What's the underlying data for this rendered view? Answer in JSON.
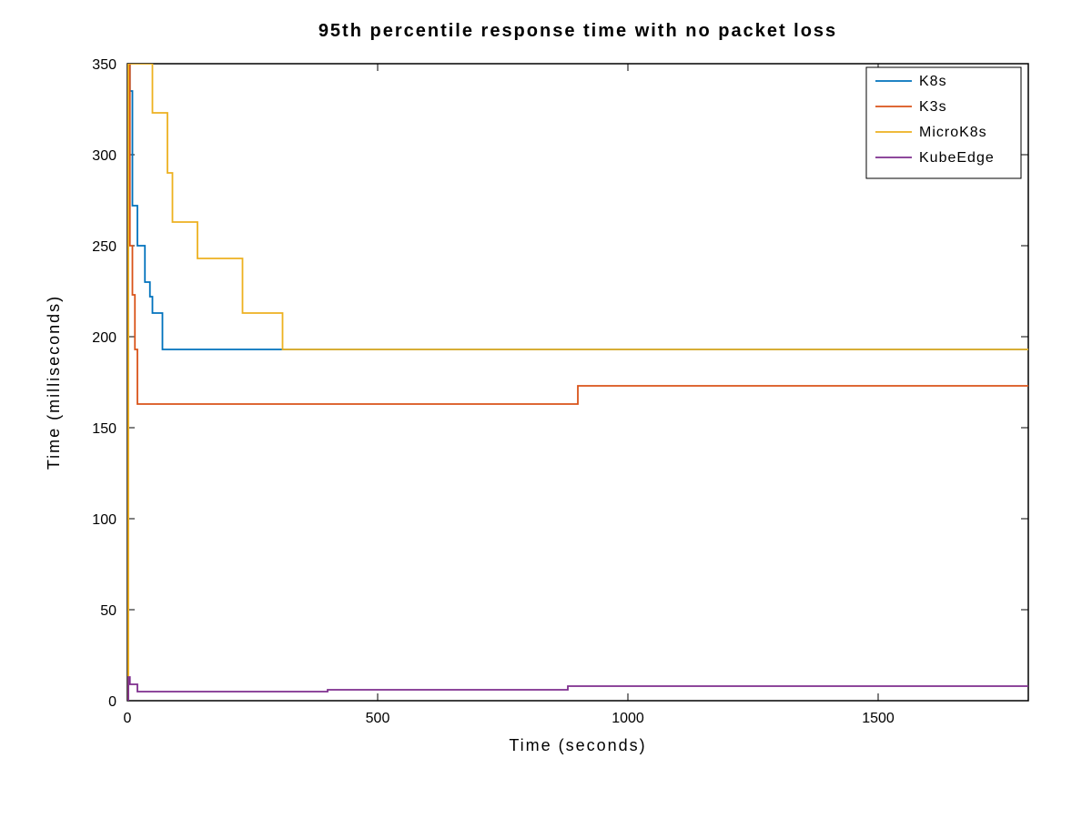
{
  "chart_data": {
    "type": "line",
    "title": "95th percentile response time with no packet loss",
    "xlabel": "Time (seconds)",
    "ylabel": "Time (milliseconds)",
    "xlim": [
      0,
      1800
    ],
    "ylim": [
      0,
      350
    ],
    "xticks": [
      0,
      500,
      1000,
      1500
    ],
    "yticks": [
      0,
      50,
      100,
      150,
      200,
      250,
      300,
      350
    ],
    "legend_position": "upper-right",
    "colors": {
      "K8s": "#0072BD",
      "K3s": "#D95319",
      "MicroK8s": "#EDB120",
      "KubeEdge": "#7E2F8E"
    },
    "series": [
      {
        "name": "K8s",
        "x": [
          0,
          2,
          5,
          10,
          15,
          20,
          25,
          35,
          45,
          50,
          60,
          70,
          80,
          300,
          1800
        ],
        "y": [
          0,
          350,
          335,
          272,
          272,
          250,
          250,
          230,
          222,
          213,
          213,
          193,
          193,
          193,
          193
        ]
      },
      {
        "name": "K3s",
        "x": [
          0,
          2,
          5,
          10,
          15,
          20,
          900,
          900,
          1800
        ],
        "y": [
          0,
          350,
          250,
          223,
          193,
          163,
          163,
          173,
          173
        ]
      },
      {
        "name": "MicroK8s",
        "x": [
          0,
          2,
          5,
          30,
          50,
          60,
          80,
          90,
          120,
          140,
          220,
          230,
          300,
          310,
          1800
        ],
        "y": [
          0,
          350,
          350,
          350,
          323,
          323,
          290,
          263,
          263,
          243,
          243,
          213,
          213,
          193,
          193
        ]
      },
      {
        "name": "KubeEdge",
        "x": [
          0,
          2,
          5,
          20,
          390,
          400,
          870,
          880,
          1800
        ],
        "y": [
          0,
          13,
          9,
          5,
          5,
          6,
          6,
          8,
          8
        ]
      }
    ]
  }
}
